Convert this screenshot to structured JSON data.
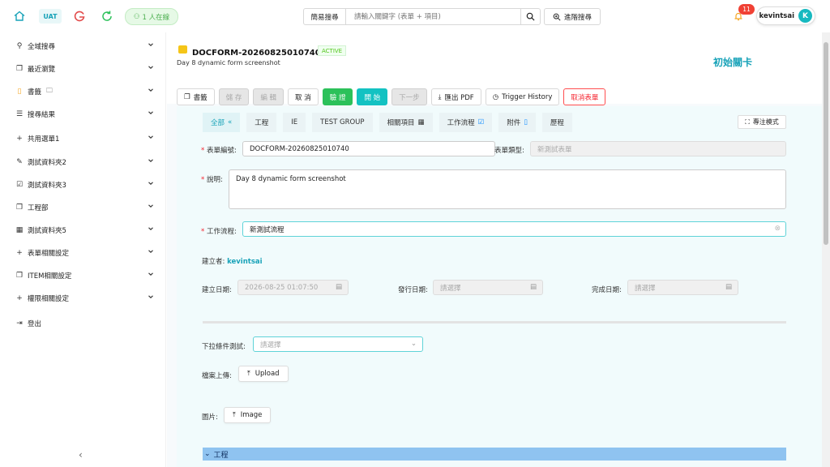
{
  "topbar": {
    "env_label": "UAT",
    "online_text": "1 人在線",
    "search_type": "簡易搜尋",
    "search_placeholder": "請輸入關鍵字 (表單 + 項目)",
    "advanced_search": "進階搜尋",
    "notification_count": "11",
    "username": "kevintsai",
    "avatar_letter": "K"
  },
  "sidebar": {
    "items": [
      {
        "label": "全域搜尋",
        "icon": "search-icon"
      },
      {
        "label": "最近瀏覽",
        "icon": "copy-icon"
      },
      {
        "label": "書籤",
        "icon": "bookmark-icon",
        "extra_icon": "folder-icon"
      },
      {
        "label": "搜尋結果",
        "icon": "list-icon"
      },
      {
        "label": "共用選單1",
        "icon": "plus-icon"
      },
      {
        "label": "測試資料夾2",
        "icon": "edit-icon"
      },
      {
        "label": "測試資料夾3",
        "icon": "checkbox-icon"
      },
      {
        "label": "工程部",
        "icon": "copy-icon"
      },
      {
        "label": "測試資料夾5",
        "icon": "table-icon"
      },
      {
        "label": "表單相關設定",
        "icon": "plus-icon"
      },
      {
        "label": "ITEM相關設定",
        "icon": "copy-icon"
      },
      {
        "label": "權限相關設定",
        "icon": "plus-icon"
      }
    ],
    "logout": "登出"
  },
  "document": {
    "title": "DOCFORM-20260825010740ー",
    "status": "ACTIVE",
    "subtitle": "Day 8 dynamic form screenshot",
    "stage": "初始關卡"
  },
  "toolbar": {
    "bookmark": "書籤",
    "save": "儲 存",
    "edit": "編 輯",
    "cancel": "取 消",
    "validate": "驗 證",
    "start": "開 始",
    "next": "下一步",
    "export_pdf": "匯出 PDF",
    "trigger_history": "Trigger History",
    "cancel_form": "取消表單"
  },
  "tabs": {
    "items": [
      "全部",
      "工程",
      "IE",
      "TEST GROUP",
      "相關項目",
      "工作流程",
      "附件",
      "歷程"
    ],
    "focus_mode": "專注模式"
  },
  "form": {
    "form_no_label": "表單編號:",
    "form_no_value": "DOCFORM-20260825010740",
    "form_type_label": "表單類型:",
    "form_type_value": "新測試表單",
    "desc_label": "說明:",
    "desc_value": "Day 8 dynamic form screenshot",
    "workflow_label": "工作流程:",
    "workflow_value": "新測試流程",
    "creator_label": "建立者:",
    "creator_value": "kevintsai",
    "created_date_label": "建立日期:",
    "created_date_value": "2026-08-25 01:07:50",
    "issue_date_label": "發行日期:",
    "issue_date_placeholder": "請選擇",
    "complete_date_label": "完成日期:",
    "complete_date_placeholder": "請選擇",
    "dropdown_label": "下拉條件測試:",
    "dropdown_placeholder": "請選擇",
    "upload_label": "檔案上傳:",
    "upload_button": "Upload",
    "image_label": "圖片:",
    "image_button": "Image",
    "section_title": "工程"
  },
  "colors": {
    "accent": "#17a2b8",
    "validate": "#2cc15a",
    "start": "#13c2c2",
    "danger": "#f5222d",
    "section_bar": "#8fc3f0"
  }
}
